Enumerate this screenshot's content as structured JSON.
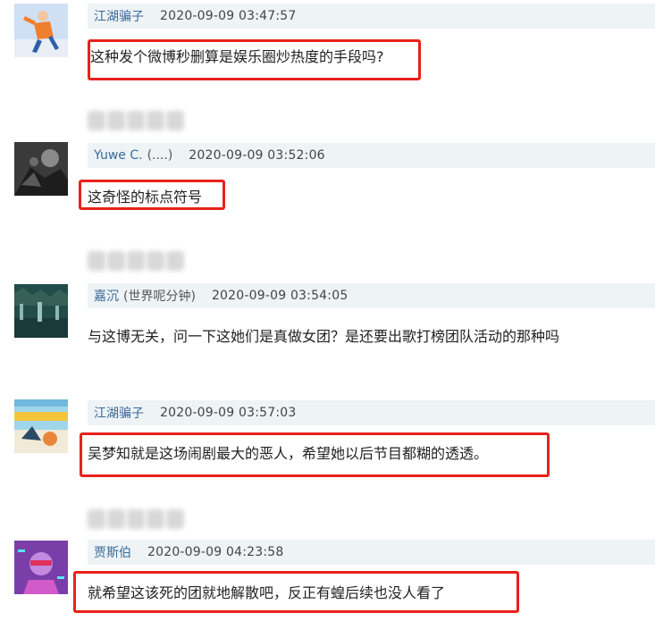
{
  "comments": [
    {
      "username": "江湖骗子",
      "username_note": "",
      "timestamp": "2020-09-09 03:47:57",
      "text": "这种发个微博秒删算是娱乐圈炒热度的手段吗?",
      "highlighted": true
    },
    {
      "username": "Yuwe C.",
      "username_note": "(....)",
      "timestamp": "2020-09-09 03:52:06",
      "text": "这奇怪的标点符号",
      "highlighted": true
    },
    {
      "username": "嘉沉",
      "username_note": "(世界呢分钟)",
      "timestamp": "2020-09-09 03:54:05",
      "text": "与这博无关，问一下这她们是真做女团？是还要出歌打榜团队活动的那种吗",
      "highlighted": false
    },
    {
      "username": "江湖骗子",
      "username_note": "",
      "timestamp": "2020-09-09 03:57:03",
      "text": "吴梦知就是这场闹剧最大的恶人，希望她以后节目都糊的透透。",
      "highlighted": true
    },
    {
      "username": "贾斯伯",
      "username_note": "",
      "timestamp": "2020-09-09 04:23:58",
      "text": "就希望这该死的团就地解散吧，反正有蝗后续也没人看了",
      "highlighted": true
    }
  ],
  "colors": {
    "highlight": "#e8211c",
    "meta_background": "#eef3f6",
    "username": "#3b6a95"
  }
}
